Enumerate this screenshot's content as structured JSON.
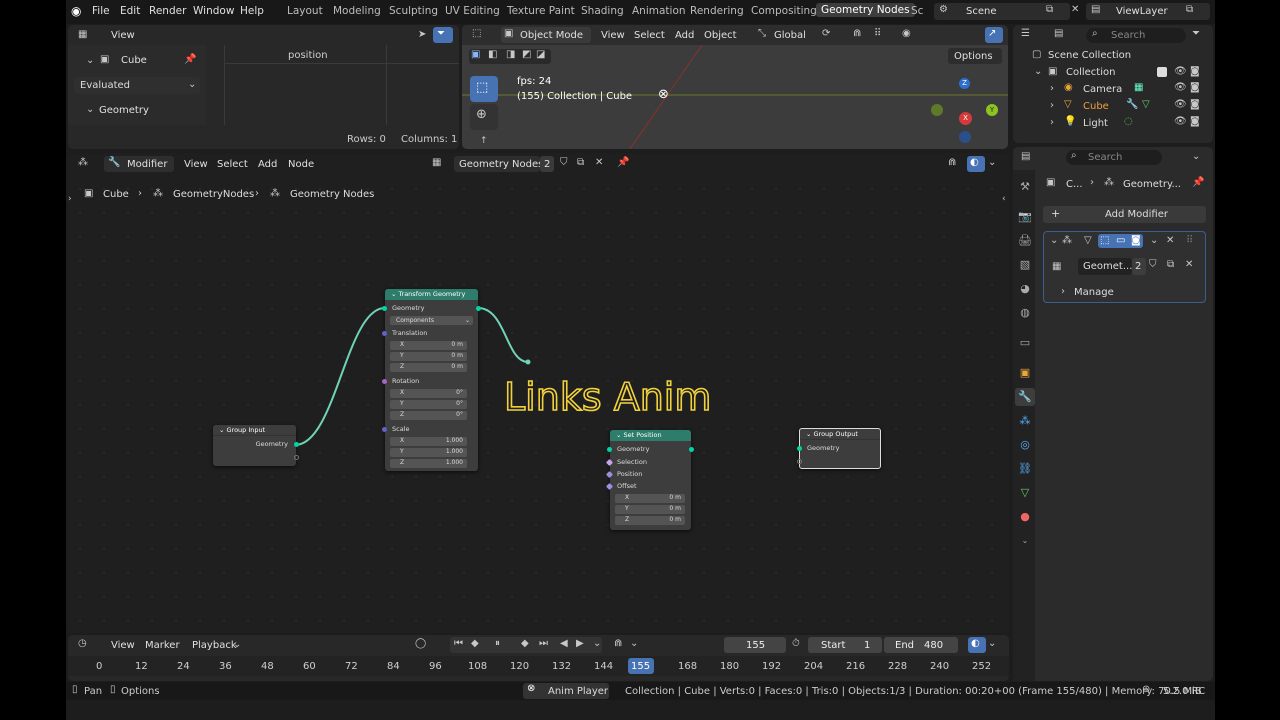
{
  "menubar": {
    "items": [
      "File",
      "Edit",
      "Render",
      "Window",
      "Help"
    ],
    "workspaces": [
      "Layout",
      "Modeling",
      "Sculpting",
      "UV Editing",
      "Texture Paint",
      "Shading",
      "Animation",
      "Rendering",
      "Compositing",
      "Geometry Nodes",
      "Sc"
    ],
    "active_workspace": "Geometry Nodes",
    "scene": "Scene",
    "view_layer": "ViewLayer"
  },
  "spreadsheet": {
    "view": "View",
    "object": "Cube",
    "evaluated": "Evaluated",
    "geometry": "Geometry",
    "column": "position",
    "rows": "Rows: 0",
    "columns": "Columns: 1"
  },
  "viewport": {
    "mode": "Object Mode",
    "menus": [
      "View",
      "Select",
      "Add",
      "Object"
    ],
    "orientation": "Global",
    "options": "Options",
    "fps": "fps: 24",
    "info": "(155) Collection | Cube",
    "gizmo": {
      "z": "Z",
      "x": "X",
      "y": "Y"
    }
  },
  "outliner": {
    "search": "Search",
    "scene_collection": "Scene Collection",
    "collection": "Collection",
    "items": [
      "Camera",
      "Cube",
      "Light"
    ]
  },
  "properties": {
    "search": "Search",
    "breadcrumb_obj": "C...",
    "breadcrumb_mod": "Geometry...",
    "add_modifier": "Add Modifier",
    "modifier_name": "Geomet...",
    "users": "2",
    "manage": "Manage"
  },
  "node_editor": {
    "editor": "Modifier",
    "menus": [
      "View",
      "Select",
      "Add",
      "Node"
    ],
    "tree": "Geometry Nodes",
    "users": "2",
    "breadcrumb": [
      "Cube",
      "GeometryNodes",
      "Geometry Nodes"
    ],
    "overlay_text": "Links Anim",
    "group_input": {
      "title": "Group Input",
      "out": "Geometry"
    },
    "transform": {
      "title": "Transform Geometry",
      "geometry": "Geometry",
      "mode": "Components",
      "translation": "Translation",
      "rotation": "Rotation",
      "scale": "Scale",
      "t": [
        {
          "l": "X",
          "v": "0 m"
        },
        {
          "l": "Y",
          "v": "0 m"
        },
        {
          "l": "Z",
          "v": "0 m"
        }
      ],
      "r": [
        {
          "l": "X",
          "v": "0°"
        },
        {
          "l": "Y",
          "v": "0°"
        },
        {
          "l": "Z",
          "v": "0°"
        }
      ],
      "s": [
        {
          "l": "X",
          "v": "1.000"
        },
        {
          "l": "Y",
          "v": "1.000"
        },
        {
          "l": "Z",
          "v": "1.000"
        }
      ]
    },
    "set_position": {
      "title": "Set Position",
      "geometry": "Geometry",
      "selection": "Selection",
      "position": "Position",
      "offset": "Offset",
      "o": [
        {
          "l": "X",
          "v": "0 m"
        },
        {
          "l": "Y",
          "v": "0 m"
        },
        {
          "l": "Z",
          "v": "0 m"
        }
      ]
    },
    "group_output": {
      "title": "Group Output",
      "in": "Geometry"
    }
  },
  "timeline": {
    "menus": [
      "View",
      "Marker",
      "Playback"
    ],
    "frame": "155",
    "start_label": "Start",
    "start": "1",
    "end_label": "End",
    "end": "480",
    "ticks": [
      "0",
      "12",
      "24",
      "36",
      "48",
      "60",
      "72",
      "84",
      "96",
      "108",
      "120",
      "132",
      "144",
      "155",
      "168",
      "180",
      "192",
      "204",
      "216",
      "228",
      "240",
      "252"
    ]
  },
  "statusbar": {
    "pan": "Pan",
    "options": "Options",
    "anim_player": "Anim Player",
    "stats": "Collection | Cube | Verts:0 | Faces:0 | Tris:0 | Objects:1/3 | Duration: 00:20+00 (Frame 155/480) | Memory: 70.5 MiB",
    "version": "5.2.0 RC"
  }
}
